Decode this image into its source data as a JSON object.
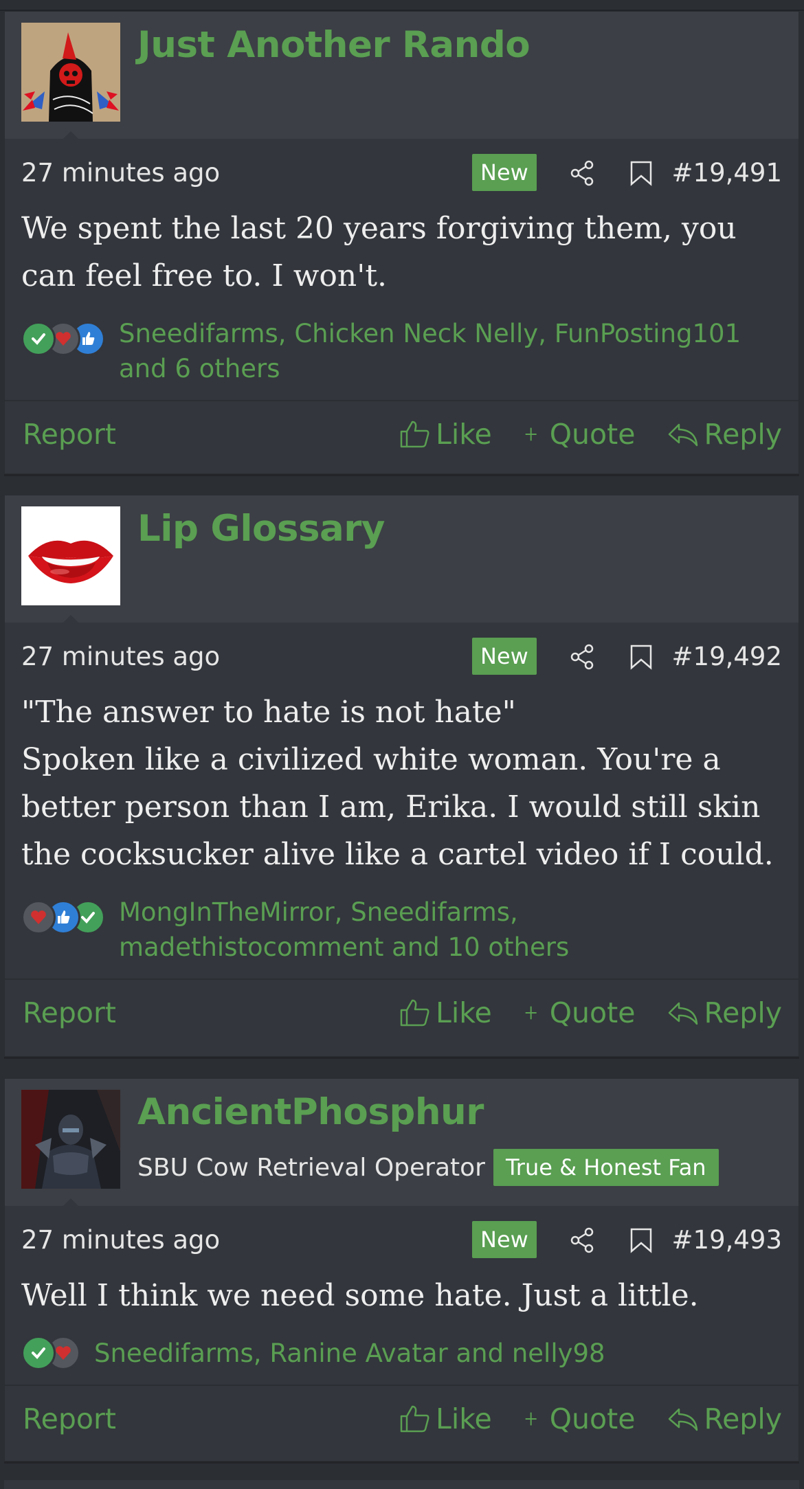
{
  "colors": {
    "accent": "#5a9f52",
    "background": "#2b2e33",
    "post_bg": "#33363c",
    "user_bar_bg": "#3c3f45",
    "check": "#43a05a",
    "heart": "#d0302f",
    "like": "#2f7fd6"
  },
  "icons": {
    "share": "share-icon",
    "bookmark": "bookmark-icon",
    "like": "thumbs-up-icon",
    "quote": "plus-icon",
    "reply": "reply-arrow-icon"
  },
  "posts": [
    {
      "username": "Just Another Rando",
      "user_title": "",
      "user_badge": "",
      "time": "27 minutes ago",
      "new_label": "New",
      "post_number": "#19,491",
      "body_lines": [
        "We spent the last 20 years forgiving them, you can feel free to. I won't."
      ],
      "reactions": [
        "check",
        "heart",
        "like"
      ],
      "reaction_text": "Sneedifarms, Chicken Neck Nelly, FunPosting101 and 6 others",
      "report_label": "Report",
      "like_label": "Like",
      "quote_label": "Quote",
      "reply_label": "Reply"
    },
    {
      "username": "Lip Glossary",
      "user_title": "",
      "user_badge": "",
      "time": "27 minutes ago",
      "new_label": "New",
      "post_number": "#19,492",
      "body_lines": [
        "\"The answer to hate is not hate\"",
        "Spoken like a civilized white woman. You're a better person than I am, Erika. I would still skin the cocksucker alive like a cartel video if I could."
      ],
      "reactions": [
        "heart",
        "like",
        "check"
      ],
      "reaction_text": "MongInTheMirror, Sneedifarms, madethistocomment and 10 others",
      "report_label": "Report",
      "like_label": "Like",
      "quote_label": "Quote",
      "reply_label": "Reply"
    },
    {
      "username": "AncientPhosphur",
      "user_title": "SBU Cow Retrieval Operator",
      "user_badge": "True & Honest Fan",
      "time": "27 minutes ago",
      "new_label": "New",
      "post_number": "#19,493",
      "body_lines": [
        "Well I think we need some hate. Just a little."
      ],
      "reactions": [
        "check",
        "heart"
      ],
      "reaction_text": "Sneedifarms, Ranine Avatar and nelly98",
      "report_label": "Report",
      "like_label": "Like",
      "quote_label": "Quote",
      "reply_label": "Reply"
    }
  ]
}
